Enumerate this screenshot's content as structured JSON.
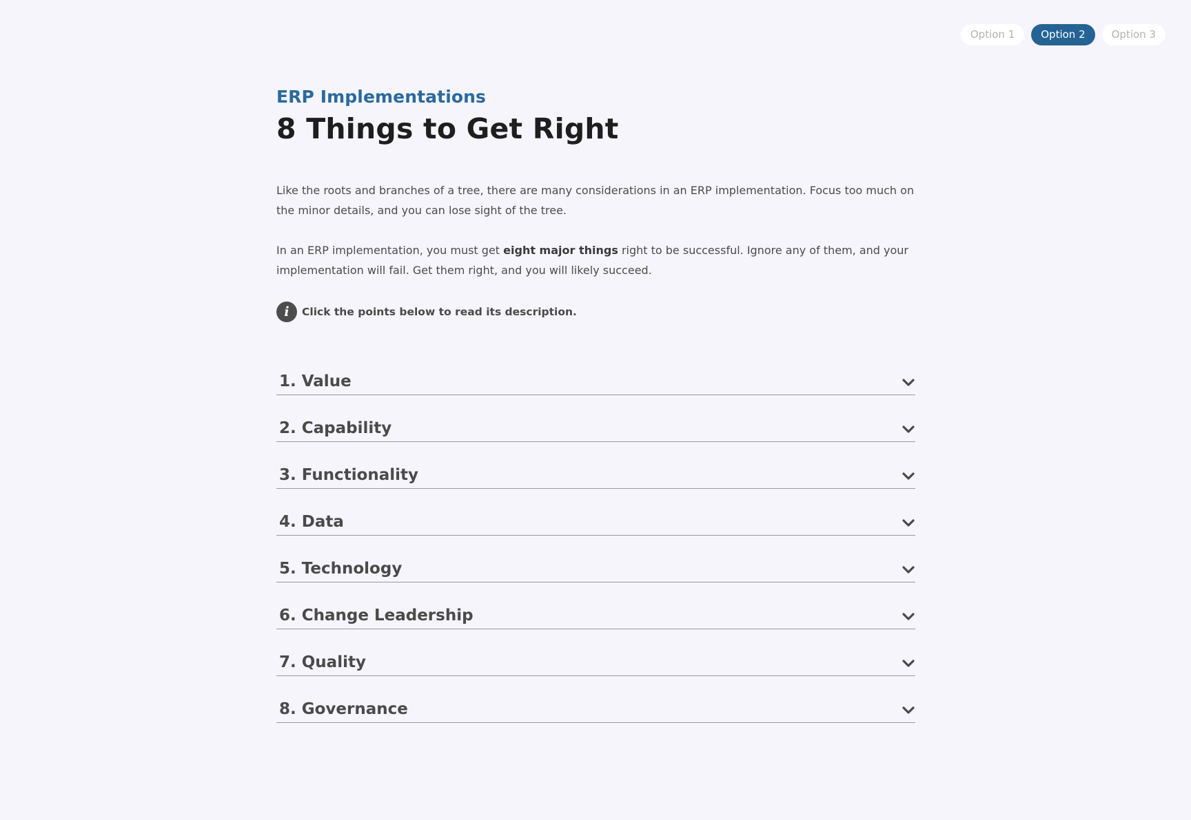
{
  "options": [
    "Option 1",
    "Option 2",
    "Option 3"
  ],
  "selected_option": "Option 2",
  "header": {
    "eyebrow": "ERP Implementations",
    "title": "8 Things to Get Right"
  },
  "intro": {
    "paragraph1": "Like the roots and branches of a tree, there are many considerations in an ERP implementation. Focus too much on the minor details, and you can lose sight of the tree.",
    "paragraph2_before": "In an ERP implementation, you must get ",
    "paragraph2_bold": "eight major things",
    "paragraph2_after": " right to be successful. Ignore any of them, and your implementation will fail. Get them right, and you will likely succeed."
  },
  "hint": {
    "icon": "info-icon",
    "icon_glyph": "i",
    "text": "Click the points below to read its description."
  },
  "accordion": {
    "items": [
      {
        "label": "1. Value"
      },
      {
        "label": "2. Capability"
      },
      {
        "label": "3. Functionality"
      },
      {
        "label": "4. Data"
      },
      {
        "label": "5. Technology"
      },
      {
        "label": "6. Change Leadership"
      },
      {
        "label": "7. Quality"
      },
      {
        "label": "8. Governance"
      }
    ],
    "chevron_icon": "chevron-down-icon"
  },
  "colors": {
    "background": "#f5f5fb",
    "accent": "#246394",
    "eyebrow": "#2a6a9c",
    "title": "#1e1e1e",
    "text": "#4a4a4a"
  }
}
